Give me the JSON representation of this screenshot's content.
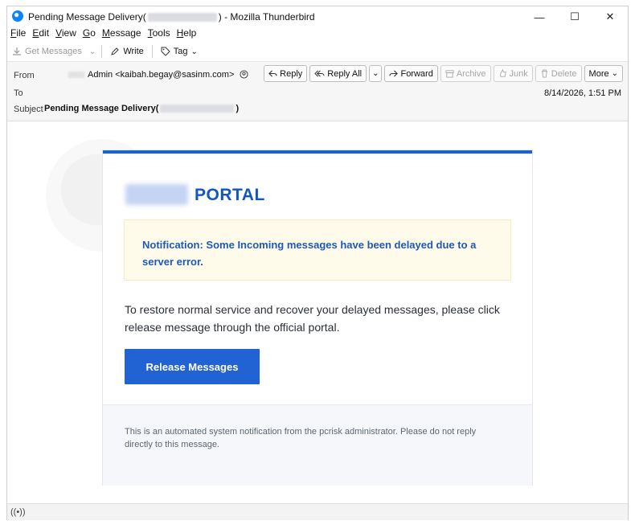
{
  "window": {
    "title_prefix": "Pending Message Delivery(",
    "title_suffix": ") - Mozilla Thunderbird",
    "minimize_glyph": "—",
    "maximize_glyph": "☐",
    "close_glyph": "✕"
  },
  "menu": [
    {
      "accel": "F",
      "rest": "ile"
    },
    {
      "accel": "E",
      "rest": "dit"
    },
    {
      "accel": "V",
      "rest": "iew"
    },
    {
      "accel": "G",
      "rest": "o"
    },
    {
      "accel": "M",
      "rest": "essage"
    },
    {
      "accel": "T",
      "rest": "ools"
    },
    {
      "accel": "H",
      "rest": "elp"
    }
  ],
  "toolbar": {
    "get_messages": "Get Messages",
    "write": "Write",
    "tag": "Tag"
  },
  "header": {
    "from_label": "From",
    "from_value": "Admin <kaibah.begay@sasinm.com>",
    "to_label": "To",
    "subject_label": "Subject",
    "subject_prefix": "Pending Message Delivery(",
    "subject_suffix": ")",
    "date": "8/14/2026, 1:51 PM",
    "actions": {
      "reply": "Reply",
      "reply_all": "Reply All",
      "forward": "Forward",
      "archive": "Archive",
      "junk": "Junk",
      "delete": "Delete",
      "more": "More"
    }
  },
  "email": {
    "portal_title": "PORTAL",
    "notification": "Notification: Some Incoming messages have been delayed due to a server error.",
    "body": "To restore normal service and recover your delayed messages, please click release message  through the official portal.",
    "button": "Release Messages",
    "footer": "This is an automated system notification from the pcrisk administrator. Please do not reply directly to this message."
  },
  "colors": {
    "accent": "#1563d8",
    "button": "#2163d3",
    "notify_bg": "#fffbea",
    "notify_text": "#1d59b8"
  }
}
